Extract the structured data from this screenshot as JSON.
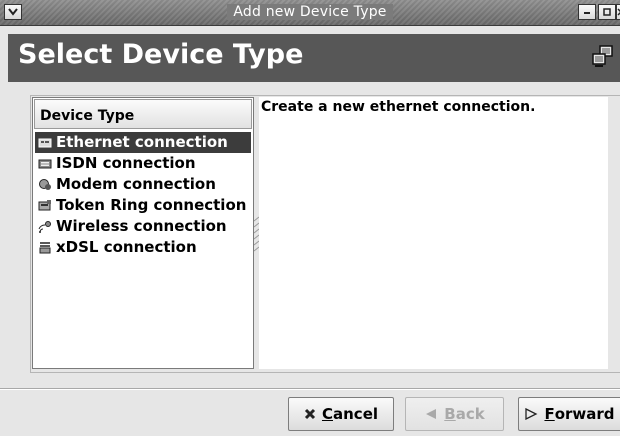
{
  "window": {
    "title": "Add new Device Type"
  },
  "header": {
    "title": "Select Device Type",
    "icon": "network-computer-icon"
  },
  "list": {
    "header": "Device Type",
    "items": [
      {
        "label": "Ethernet connection",
        "icon": "ethernet-card-icon",
        "selected": true
      },
      {
        "label": "ISDN connection",
        "icon": "isdn-card-icon",
        "selected": false
      },
      {
        "label": "Modem connection",
        "icon": "modem-icon",
        "selected": false
      },
      {
        "label": "Token Ring connection",
        "icon": "token-ring-card-icon",
        "selected": false
      },
      {
        "label": "Wireless connection",
        "icon": "wireless-icon",
        "selected": false
      },
      {
        "label": "xDSL connection",
        "icon": "xdsl-icon",
        "selected": false
      }
    ]
  },
  "description": "Create a new ethernet connection.",
  "buttons": {
    "cancel": {
      "first": "C",
      "rest": "ancel"
    },
    "back": {
      "first": "B",
      "rest": "ack"
    },
    "forward": {
      "first": "F",
      "rest": "orward"
    }
  },
  "colors": {
    "selection": "#3c3c3c",
    "header_band": "#575757"
  }
}
